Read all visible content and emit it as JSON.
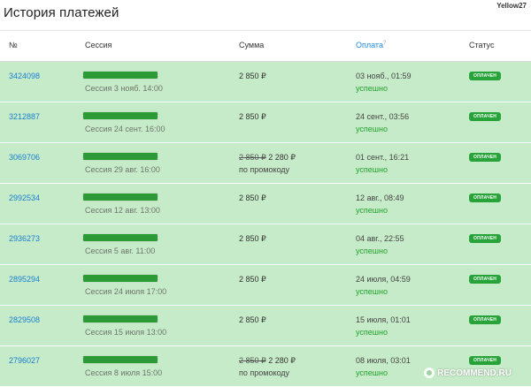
{
  "page": {
    "title": "История платежей",
    "watermark": "Yellow27"
  },
  "table": {
    "headers": {
      "num": "№",
      "session": "Сессия",
      "sum": "Сумма",
      "payment": "Оплата",
      "payment_help": "?",
      "status": "Статус"
    },
    "rows": [
      {
        "id": "3424098",
        "session_date": "Сессия 3 нояб. 14:00",
        "sum_old": "",
        "sum": "2 850 ₽",
        "sum_note": "",
        "paid_at": "03 нояб., 01:59",
        "pay_status": "успешно",
        "status": "ОПЛАЧЕН"
      },
      {
        "id": "3212887",
        "session_date": "Сессия 24 сент. 16:00",
        "sum_old": "",
        "sum": "2 850 ₽",
        "sum_note": "",
        "paid_at": "24 сент., 03:56",
        "pay_status": "успешно",
        "status": "ОПЛАЧЕН"
      },
      {
        "id": "3069706",
        "session_date": "Сессия 29 авг. 16:00",
        "sum_old": "2 850 ₽",
        "sum": "2 280 ₽",
        "sum_note": "по промокоду",
        "paid_at": "01 сент., 16:21",
        "pay_status": "успешно",
        "status": "ОПЛАЧЕН"
      },
      {
        "id": "2992534",
        "session_date": "Сессия 12 авг. 13:00",
        "sum_old": "",
        "sum": "2 850 ₽",
        "sum_note": "",
        "paid_at": "12 авг., 08:49",
        "pay_status": "успешно",
        "status": "ОПЛАЧЕН"
      },
      {
        "id": "2936273",
        "session_date": "Сессия 5 авг. 11:00",
        "sum_old": "",
        "sum": "2 850 ₽",
        "sum_note": "",
        "paid_at": "04 авг., 22:55",
        "pay_status": "успешно",
        "status": "ОПЛАЧЕН"
      },
      {
        "id": "2895294",
        "session_date": "Сессия 24 июля 17:00",
        "sum_old": "",
        "sum": "2 850 ₽",
        "sum_note": "",
        "paid_at": "24 июля, 04:59",
        "pay_status": "успешно",
        "status": "ОПЛАЧЕН"
      },
      {
        "id": "2829508",
        "session_date": "Сессия 15 июля 13:00",
        "sum_old": "",
        "sum": "2 850 ₽",
        "sum_note": "",
        "paid_at": "15 июля, 01:01",
        "pay_status": "успешно",
        "status": "ОПЛАЧЕН"
      },
      {
        "id": "2796027",
        "session_date": "Сессия 8 июля 15:00",
        "sum_old": "2 850 ₽",
        "sum": "2 280 ₽",
        "sum_note": "по промокоду",
        "paid_at": "08 июля, 03:01",
        "pay_status": "успешно",
        "status": "ОПЛАЧЕН"
      }
    ]
  },
  "site_watermark": {
    "text": "RECOMMEND.RU"
  },
  "colors": {
    "row_bg": "#c6ebc8",
    "link": "#1a7fd1",
    "success": "#22a12f",
    "badge": "#27a33a",
    "redaction": "#2d9a38"
  }
}
